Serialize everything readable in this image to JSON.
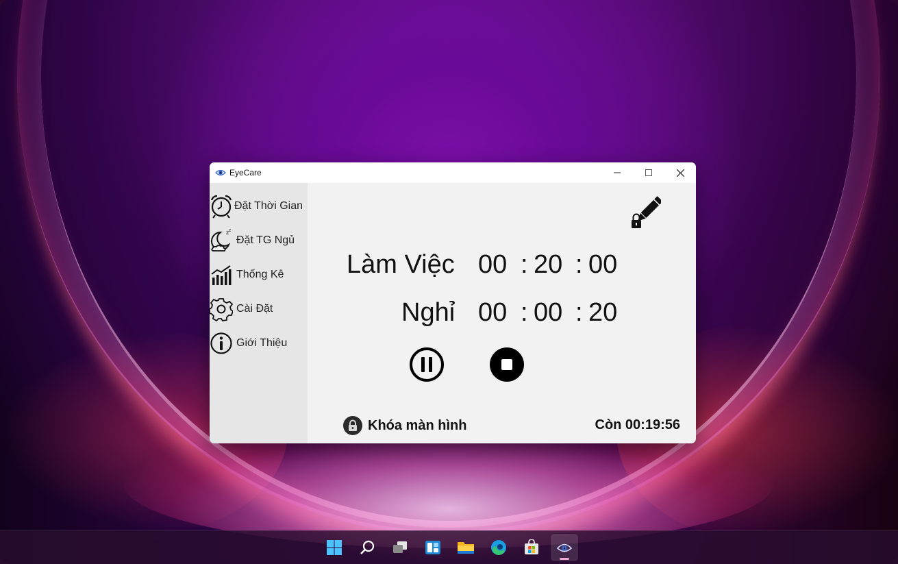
{
  "window": {
    "title": "EyeCare",
    "controls": [
      "minimize",
      "maximize",
      "close"
    ]
  },
  "sidebar": {
    "items": [
      {
        "label": "Đặt Thời Gian",
        "icon": "alarm-clock-icon"
      },
      {
        "label": "Đặt TG Ngủ",
        "icon": "sleep-moon-icon"
      },
      {
        "label": "Thống Kê",
        "icon": "stats-chart-icon"
      },
      {
        "label": "Cài Đặt",
        "icon": "gear-icon"
      },
      {
        "label": "Giới Thiệu",
        "icon": "info-icon"
      }
    ]
  },
  "main": {
    "edit_icon": "edit-lock-icon",
    "work": {
      "label": "Làm Việc",
      "hours": "00",
      "minutes": "20",
      "seconds": "00"
    },
    "rest": {
      "label": "Nghỉ",
      "hours": "00",
      "minutes": "00",
      "seconds": "20"
    },
    "colon": ":",
    "pause_icon": "pause-icon",
    "stop_icon": "stop-icon",
    "lock_label": "Khóa màn hình",
    "remaining": "Còn 00:19:56"
  },
  "taskbar": {
    "items": [
      "start-icon",
      "search-icon",
      "task-view-icon",
      "widgets-icon",
      "file-explorer-icon",
      "edge-icon",
      "store-icon",
      "eyecare-icon"
    ],
    "active": "eyecare-icon"
  }
}
